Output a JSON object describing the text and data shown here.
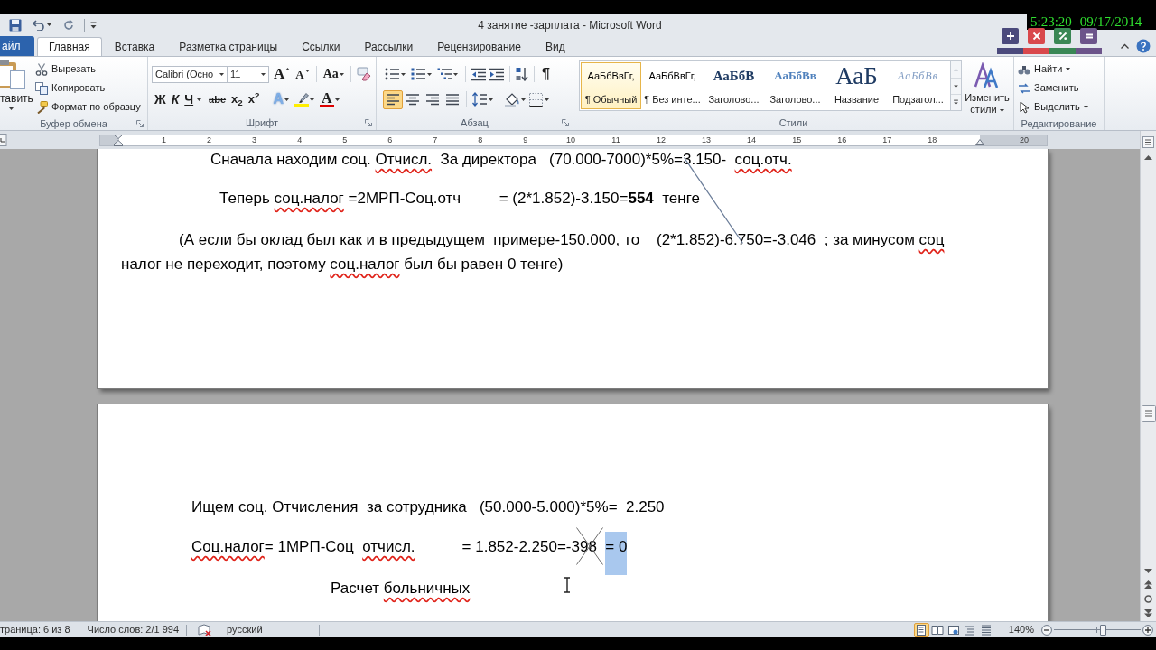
{
  "title_bar": {
    "title": "4 занятие -зарплата - Microsoft Word"
  },
  "recorder_overlay": {
    "time": "5:23:20",
    "date": "09/17/2014",
    "buttons": [
      {
        "kind": "plus",
        "color": "#4b4a7c"
      },
      {
        "kind": "close",
        "color": "#d9484c"
      },
      {
        "kind": "percent",
        "color": "#3a8755"
      },
      {
        "kind": "equals",
        "color": "#6c548a"
      }
    ]
  },
  "tabs": [
    {
      "kind": "file",
      "label": "айл",
      "selected": false
    },
    {
      "kind": "tab",
      "label": "Главная",
      "selected": true
    },
    {
      "kind": "tab",
      "label": "Вставка",
      "selected": false
    },
    {
      "kind": "tab",
      "label": "Разметка страницы",
      "selected": false
    },
    {
      "kind": "tab",
      "label": "Ссылки",
      "selected": false
    },
    {
      "kind": "tab",
      "label": "Рассылки",
      "selected": false
    },
    {
      "kind": "tab",
      "label": "Рецензирование",
      "selected": false
    },
    {
      "kind": "tab",
      "label": "Вид",
      "selected": false
    }
  ],
  "ribbon": {
    "clipboard": {
      "paste": "тавить",
      "commands": [
        "Вырезать",
        "Копировать",
        "Формат по образцу"
      ],
      "label": "Буфер обмена"
    },
    "font": {
      "name": "Calibri (Осно",
      "size": "11",
      "glyphs": [
        "A",
        "A",
        "Aa",
        "Ж",
        "К",
        "Ч",
        "abe",
        "x$_{2}$",
        "x$^{2}$",
        "A",
        "A"
      ],
      "label": "Шрифт"
    },
    "paragraph": {
      "pilcrow": "¶",
      "alignments": [
        {
          "selected": true
        },
        {
          "selected": false
        },
        {
          "selected": false
        },
        {
          "selected": false
        }
      ],
      "label": "Абзац"
    },
    "styles": {
      "items": [
        {
          "sample": "АаБбВвГг,",
          "name": "¶ Обычный",
          "selected": true
        },
        {
          "sample": "АаБбВвГг,",
          "name": "¶ Без инте...",
          "selected": false
        },
        {
          "sample": "АаБбВ",
          "name": "Заголово...",
          "selected": false
        },
        {
          "sample": "АаБбВв",
          "name": "Заголово...",
          "selected": false
        },
        {
          "sample": "АаБ",
          "name": "Название",
          "selected": false
        },
        {
          "sample": "АаБбВв",
          "name": "Подзагол...",
          "selected": false
        }
      ],
      "change_styles": "Изменить стили",
      "label": "Стили"
    },
    "editing": {
      "commands": [
        "Найти",
        "Заменить",
        "Выделить"
      ],
      "label": "Редактирование"
    }
  },
  "ruler": {
    "numbers": [
      "1",
      "2",
      "3",
      "4",
      "5",
      "6",
      "7",
      "8",
      "9",
      "10",
      "11",
      "12",
      "13",
      "14",
      "15",
      "16",
      "17",
      "18"
    ],
    "right_margin_numbers": [
      "20"
    ]
  },
  "pages": [
    {
      "paragraphs": [
        {
          "lines": [
            [
              {
                "text": "Сначала находим соц. ",
                "kind": "plain"
              },
              {
                "text": "Отчисл.",
                "kind": "misspelled"
              },
              {
                "text": "  За директора   (70.000-7000)*5%=3.150-  ",
                "kind": "plain"
              },
              {
                "text": "соц.отч.",
                "kind": "misspelled"
              }
            ]
          ]
        },
        {
          "lines": [
            [
              {
                "text": "Теперь ",
                "kind": "plain"
              },
              {
                "text": "соц.налог",
                "kind": "misspelled"
              },
              {
                "text": " =2МРП-Соц.отч         = (2*1.852)-3.150=**554**  тенге",
                "kind": "plain"
              }
            ]
          ]
        },
        {
          "lines": [
            [
              {
                "text": "(А если бы оклад был как и в предыдущем  примере-150.000, то    (2*1.852)-6.750=-3.046  ; за минусом ",
                "kind": "plain"
              },
              {
                "text": "соц",
                "kind": "misspelled"
              }
            ],
            [
              {
                "text": "налог не переходит, поэтому ",
                "kind": "plain"
              },
              {
                "text": "соц.налог",
                "kind": "misspelled"
              },
              {
                "text": " был бы равен 0 тенге)",
                "kind": "plain"
              }
            ]
          ]
        }
      ]
    },
    {
      "paragraphs": [
        {
          "lines": [
            [
              {
                "text": "Ищем соц. Отчисления  за сотрудника   (50.000-5.000)*5%=  2.250",
                "kind": "plain"
              }
            ]
          ]
        },
        {
          "lines": [
            [
              {
                "text": "Соц.налог",
                "kind": "misspelled"
              },
              {
                "text": "= 1МРП-Соц  ",
                "kind": "plain"
              },
              {
                "text": "отчисл.",
                "kind": "misspelled"
              },
              {
                "text": "           = 1.852-2.250=-398  ",
                "kind": "plain"
              },
              {
                "text": "= 0",
                "kind": "selected"
              }
            ]
          ]
        },
        {
          "lines": [
            [
              {
                "text": "Расчет ",
                "kind": "plain"
              },
              {
                "text": "больничных",
                "kind": "misspelled"
              }
            ]
          ]
        }
      ]
    }
  ],
  "status_bar": {
    "page": "траница: 6 из 8",
    "words": "Число слов: 2/1 994",
    "language": "русский",
    "views": [
      {
        "selected": true
      },
      {
        "selected": false
      },
      {
        "selected": false
      },
      {
        "selected": false
      },
      {
        "selected": false
      }
    ],
    "zoom": {
      "label": "140%",
      "level": 0.56
    }
  }
}
